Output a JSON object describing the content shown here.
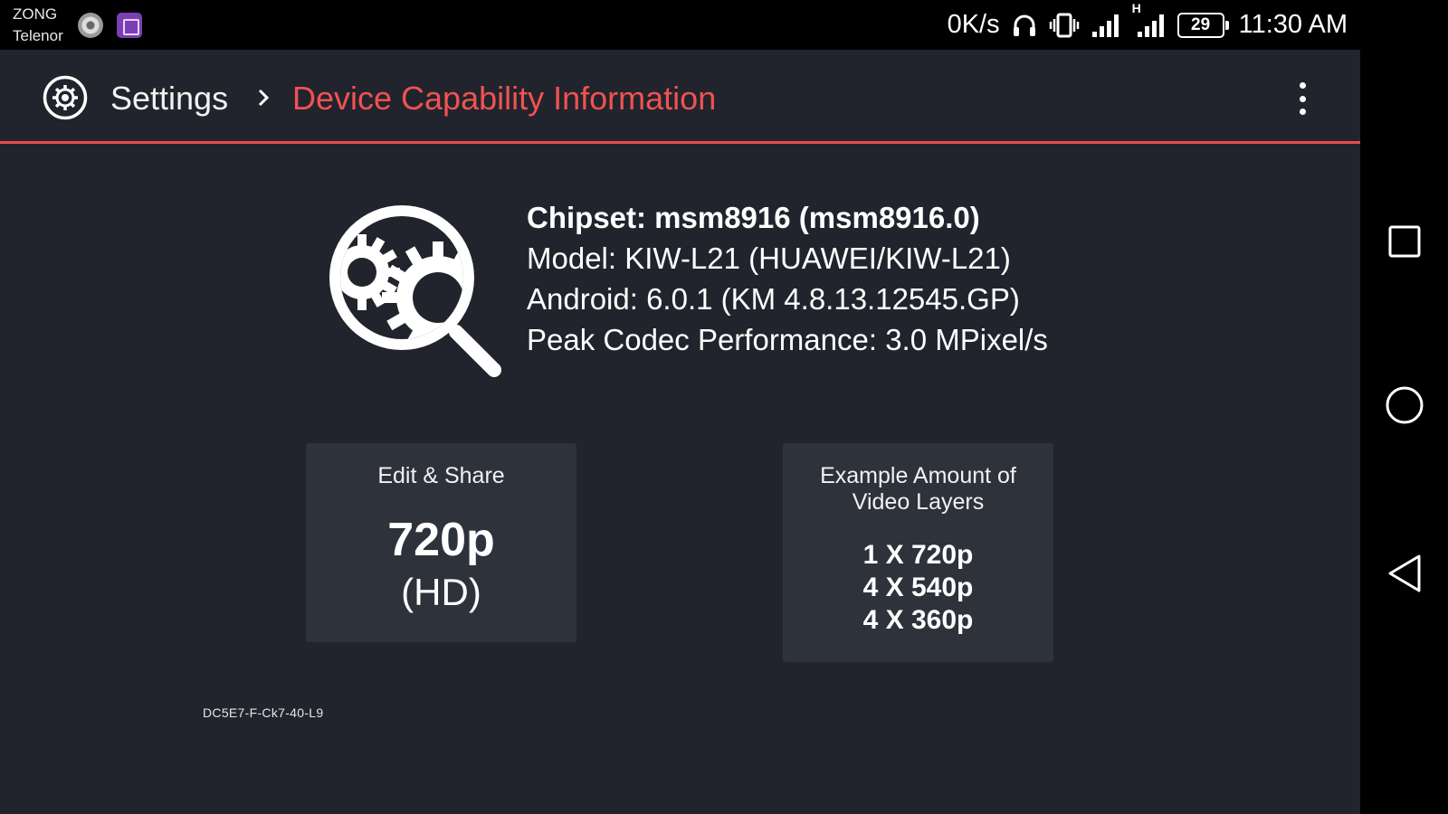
{
  "status_bar": {
    "carrier_1": "ZONG",
    "carrier_2": "Telenor",
    "net_speed": "0K/s",
    "network_type": "H",
    "battery": "29",
    "time": "11:30 AM",
    "icons": [
      "media-disc-icon",
      "gallery-app-icon",
      "headphones-icon",
      "vibrate-icon",
      "signal-icon",
      "signal-h-icon",
      "battery-icon"
    ]
  },
  "toolbar": {
    "breadcrumb_root": "Settings",
    "title": "Device Capability Information",
    "accent_color": "#f05252"
  },
  "device_info": {
    "chipset": "Chipset:  msm8916 (msm8916.0)",
    "model": "Model: KIW-L21 (HUAWEI/KIW-L21)",
    "android": "Android: 6.0.1 (KM 4.8.13.12545.GP)",
    "codec": "Peak Codec Performance:  3.0 MPixel/s"
  },
  "cards": {
    "edit_share": {
      "heading": "Edit & Share",
      "resolution": "720p",
      "resolution_label": "(HD)"
    },
    "video_layers": {
      "heading": "Example Amount of Video Layers",
      "layers": [
        "1 X 720p",
        "4 X 540p",
        "4 X 360p"
      ]
    }
  },
  "build_id": "DC5E7-F-Ck7-40-L9",
  "nav_bar": {
    "buttons": [
      "recent-apps-button",
      "home-button",
      "back-button"
    ]
  },
  "colors": {
    "background": "#21242c",
    "card": "#2d323b",
    "accent": "#e84b4b"
  }
}
